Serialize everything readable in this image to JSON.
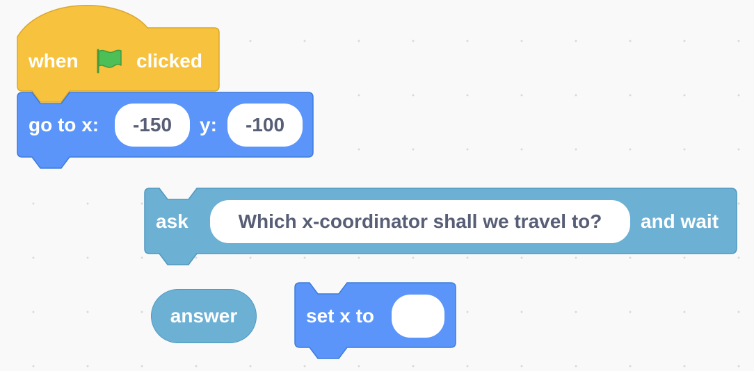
{
  "colors": {
    "events": "#f7c23d",
    "events_border": "#d9a72e",
    "motion": "#4c97ff",
    "motion_fill": "#5b95f9",
    "motion_border": "#3c7bd9",
    "sensing": "#6cb0d4",
    "sensing_border": "#4f98bf",
    "input_text": "#575e75",
    "flag_green": "#4cbf56",
    "workspace": "#f9f9f9"
  },
  "blocks": {
    "when_flag_clicked": {
      "when_label": "when",
      "flag_icon": "green-flag-icon",
      "clicked_label": "clicked"
    },
    "go_to_xy": {
      "label": "go to x:",
      "x_value": "-150",
      "y_label": "y:",
      "y_value": "-100"
    },
    "ask_and_wait": {
      "ask_label": "ask",
      "question": "Which x-coordinator shall we travel to?",
      "wait_label": "and wait"
    },
    "answer": {
      "label": "answer"
    },
    "set_x": {
      "label": "set x to",
      "value": ""
    }
  }
}
